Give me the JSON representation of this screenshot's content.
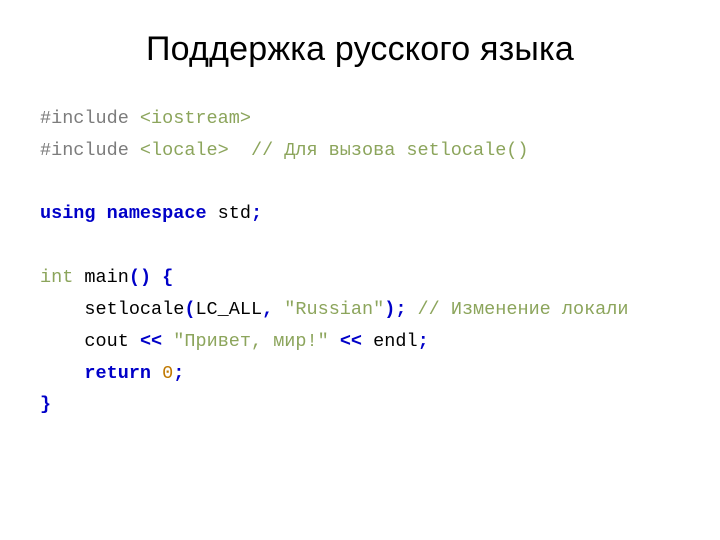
{
  "title": "Поддержка русского языка",
  "code": {
    "l1": {
      "include": "#include ",
      "header": "<iostream>"
    },
    "l2": {
      "include": "#include ",
      "header": "<locale>",
      "sp": "  ",
      "comment": "// Для вызова setlocale()"
    },
    "blank1": "",
    "l3": {
      "using": "using",
      "sp1": " ",
      "namespace": "namespace",
      "sp2": " ",
      "std": "std",
      "semi": ";"
    },
    "blank2": "",
    "l4": {
      "int": "int",
      "sp": " ",
      "main": "main",
      "paren": "()",
      "sp2": " ",
      "brace": "{"
    },
    "l5": {
      "indent": "    ",
      "fn": "setlocale",
      "open": "(",
      "arg1": "LC_ALL",
      "comma": ",",
      "sp": " ",
      "str": "\"Russian\"",
      "close": ")",
      "semi": ";",
      "sp2": " ",
      "comment": "// Изменение локали"
    },
    "l6": {
      "indent": "    ",
      "cout": "cout",
      "sp1": " ",
      "op1": "<<",
      "sp2": " ",
      "str": "\"Привет, мир!\"",
      "sp3": " ",
      "op2": "<<",
      "sp4": " ",
      "endl": "endl",
      "semi": ";"
    },
    "l7": {
      "indent": "    ",
      "ret": "return",
      "sp": " ",
      "zero": "0",
      "semi": ";"
    },
    "l8": {
      "brace": "}"
    }
  }
}
